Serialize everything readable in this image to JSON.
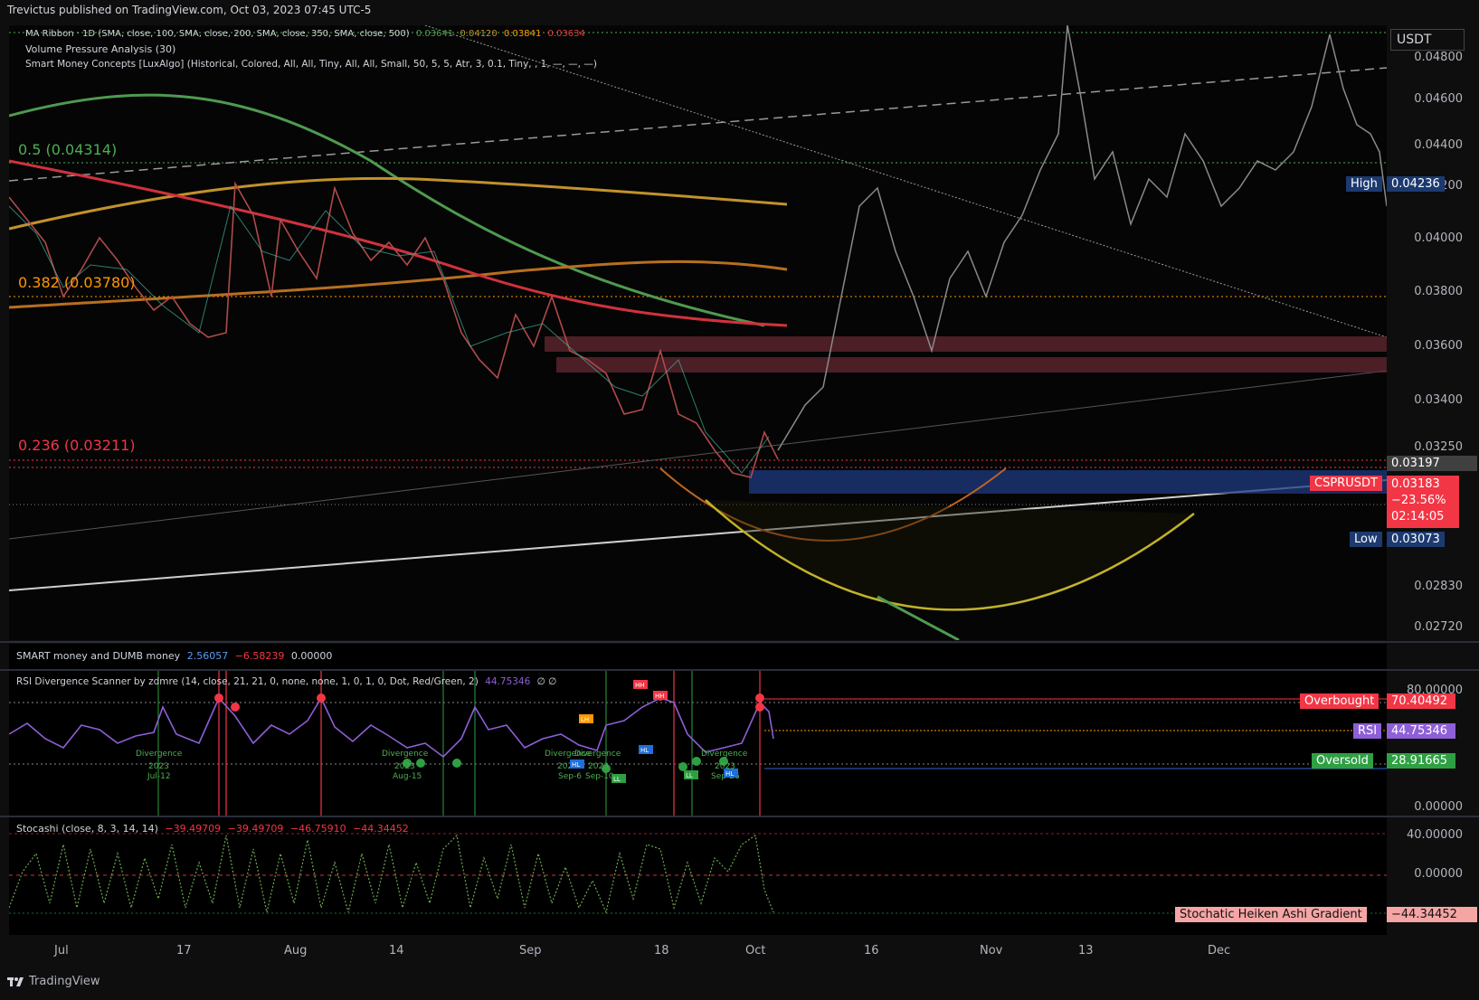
{
  "header": {
    "published_line": "Trevictus published on TradingView.com, Oct 03, 2023 07:45 UTC-5"
  },
  "main_legend": {
    "ma_ribbon": {
      "label": "MA Ribbon · 1D (SMA, close, 100, SMA, close, 200, SMA, close, 350, SMA, close, 500)",
      "v1": "0.03641",
      "v2": "0.04120",
      "v3": "0.03841",
      "v4": "0.03634"
    },
    "vpa": "Volume Pressure Analysis (30)",
    "smc": "Smart Money Concepts [LuxAlgo] (Historical, Colored, All, All, Tiny, All, All, Small, 50, 5, 5, Atr, 3, 0.1, Tiny, , 1, —, —, —)"
  },
  "fib_labels": {
    "f05": "0.5 (0.04314)",
    "f0382": "0.382 (0.03780)",
    "f0236": "0.236 (0.03211)"
  },
  "price_axis": {
    "currency_button": "USDT",
    "ticks": [
      "0.04800",
      "0.04600",
      "0.04400",
      "0.04200",
      "0.04000",
      "0.03800",
      "0.03600",
      "0.03400",
      "0.03250",
      "0.02830",
      "0.02720"
    ],
    "current_price": "0.03197",
    "symbol_tag": {
      "symbol": "CSPRUSDT",
      "price": "0.03183",
      "change": "−23.56%",
      "countdown": "02:14:05"
    },
    "high": {
      "label": "High",
      "value": "0.04236"
    },
    "low": {
      "label": "Low",
      "value": "0.03073"
    }
  },
  "smart_dumb": {
    "label": "SMART money and DUMB money",
    "v1": "2.56057",
    "v2": "−6.58239",
    "v3": "0.00000"
  },
  "rsi": {
    "label": "RSI Divergence Scanner by zdmre (14, close, 21, 21, 0, none, none, 1, 0, 1, 0, Dot, Red/Green, 2)",
    "value": "44.75346",
    "glyphs": "∅ ∅",
    "axis_ticks": [
      "80.00000",
      "0.00000"
    ],
    "overbought": {
      "label": "Overbought",
      "value": "70.40492"
    },
    "rsi_tag": {
      "label": "RSI",
      "value": "44.75346"
    },
    "oversold": {
      "label": "Oversold",
      "value": "28.91665"
    },
    "divergences": [
      {
        "label": "Divergence",
        "year": "2023",
        "date": "Jul-12"
      },
      {
        "label": "Divergence",
        "year": "2023",
        "date": "Aug-15"
      },
      {
        "label": "Divergence",
        "year": "2023",
        "date": "Sep-6"
      },
      {
        "label": "Divergence",
        "year": "2023",
        "date": "Sep-10"
      },
      {
        "label": "Divergence",
        "year": "2023",
        "date": "Sep-26"
      }
    ],
    "pivot_tags": [
      "HH",
      "HH",
      "HL",
      "LH",
      "HL",
      "LL",
      "LL",
      "HL"
    ]
  },
  "stoch": {
    "label": "Stocashi (close, 8, 3, 14, 14)",
    "v1": "−39.49709",
    "v2": "−39.49709",
    "v3": "−46.75910",
    "v4": "−44.34452",
    "axis_ticks": [
      "40.00000",
      "0.00000"
    ],
    "tag": {
      "label": "Stochatic Heiken Ashi Gradient",
      "value": "−44.34452"
    }
  },
  "time_axis": [
    "Jul",
    "17",
    "Aug",
    "14",
    "Sep",
    "18",
    "Oct",
    "16",
    "Nov",
    "13",
    "Dec"
  ],
  "footer": {
    "brand": "TradingView"
  },
  "colors": {
    "sma100": "#4f9a4f",
    "sma200": "#c2922b",
    "sma350": "#b86f1f",
    "sma500": "#d0323c",
    "rsi_line": "#8e5fd6",
    "overbought": "#f23645",
    "oversold": "#2ea043",
    "ob_zone": "#1e40a0"
  }
}
